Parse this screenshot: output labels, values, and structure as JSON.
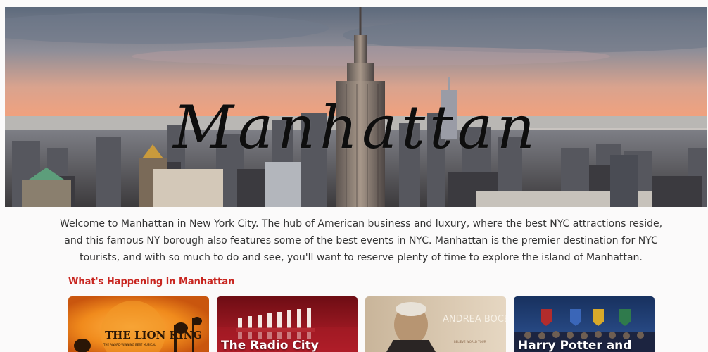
{
  "hero": {
    "title": "Manhattan"
  },
  "intro": {
    "text": "Welcome to Manhattan in New York City. The hub of American business and luxury, where the best NYC attractions reside, and this famous NY borough also features some of the best events in NYC. Manhattan is the premier destination for NYC tourists, and with so much to do and see, you'll want to reserve plenty of time to explore the island of Manhattan."
  },
  "section": {
    "heading": "What's Happening in Manhattan"
  },
  "cards": [
    {
      "poster_text": "THE LION KING",
      "poster_tagline": "THE AWARD-WINNING BEST MUSICAL",
      "title": ""
    },
    {
      "poster_text": "",
      "title": "The Radio City"
    },
    {
      "poster_text": "ANDREA BOCELLI",
      "poster_tagline": "BELIEVE WORLD TOUR",
      "title": ""
    },
    {
      "poster_text": "",
      "title": "Harry Potter and"
    }
  ],
  "colors": {
    "accent": "#c8251f",
    "body_text": "#333333",
    "background": "#fbfafa"
  }
}
